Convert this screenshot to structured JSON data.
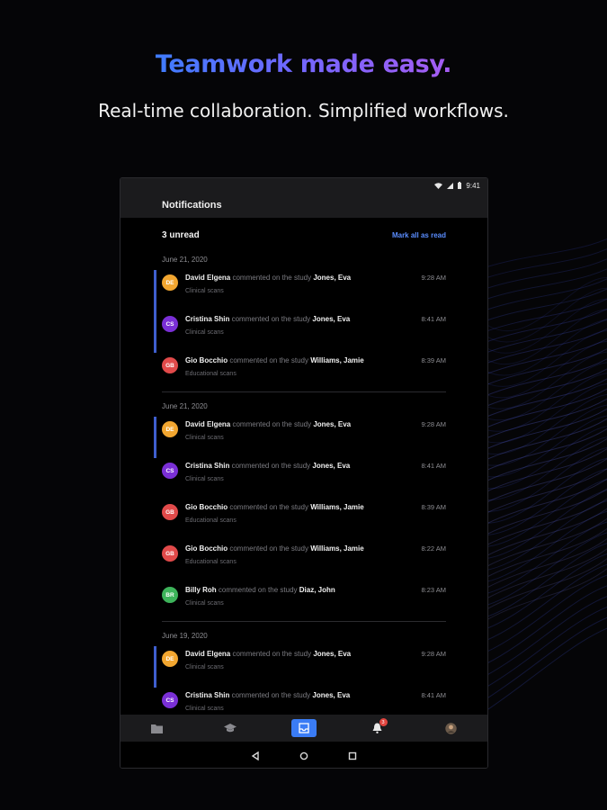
{
  "hero": {
    "title": "Teamwork made easy.",
    "subtitle": "Real-time collaboration. Simplified workflows."
  },
  "statusbar": {
    "time": "9:41"
  },
  "appbar": {
    "title": "Notifications"
  },
  "summary": {
    "unread": "3 unread",
    "mark_all": "Mark all as read"
  },
  "colors": {
    "accent": "#3a7cf5",
    "link": "#5a8dff",
    "unread_bar": "#3f5fcf",
    "badge": "#e0453f"
  },
  "groups": [
    {
      "date": "June 21, 2020",
      "items": [
        {
          "initials": "DE",
          "color": "#f2a630",
          "name": "David Elgena",
          "action": "commented on the study",
          "study": "Jones, Eva",
          "subtitle": "Clinical scans",
          "time": "9:28 AM",
          "unread": true
        },
        {
          "initials": "CS",
          "color": "#7a2fd6",
          "name": "Cristina Shin",
          "action": "commented on the study",
          "study": "Jones, Eva",
          "subtitle": "Clinical scans",
          "time": "8:41 AM",
          "unread": true
        },
        {
          "initials": "GB",
          "color": "#e14a4a",
          "name": "Gio Bocchio",
          "action": "commented on the study",
          "study": "Williams, Jamie",
          "subtitle": "Educational scans",
          "time": "8:39 AM",
          "unread": false
        }
      ]
    },
    {
      "date": "June 21, 2020",
      "items": [
        {
          "initials": "DE",
          "color": "#f2a630",
          "name": "David Elgena",
          "action": "commented on the study",
          "study": "Jones, Eva",
          "subtitle": "Clinical scans",
          "time": "9:28 AM",
          "unread": true
        },
        {
          "initials": "CS",
          "color": "#7a2fd6",
          "name": "Cristina Shin",
          "action": "commented on the study",
          "study": "Jones, Eva",
          "subtitle": "Clinical scans",
          "time": "8:41 AM",
          "unread": false
        },
        {
          "initials": "GB",
          "color": "#e14a4a",
          "name": "Gio Bocchio",
          "action": "commented on the study",
          "study": "Williams, Jamie",
          "subtitle": "Educational scans",
          "time": "8:39 AM",
          "unread": false
        },
        {
          "initials": "GB",
          "color": "#e14a4a",
          "name": "Gio Bocchio",
          "action": "commented on the study",
          "study": "Williams, Jamie",
          "subtitle": "Educational scans",
          "time": "8:22 AM",
          "unread": false
        },
        {
          "initials": "BR",
          "color": "#3db35a",
          "name": "Billy Roh",
          "action": "commented on the study",
          "study": "Diaz, John",
          "subtitle": "Clinical scans",
          "time": "8:23 AM",
          "unread": false
        }
      ]
    },
    {
      "date": "June 19, 2020",
      "items": [
        {
          "initials": "DE",
          "color": "#f2a630",
          "name": "David Elgena",
          "action": "commented on the study",
          "study": "Jones, Eva",
          "subtitle": "Clinical scans",
          "time": "9:28 AM",
          "unread": true
        },
        {
          "initials": "CS",
          "color": "#7a2fd6",
          "name": "Cristina Shin",
          "action": "commented on the study",
          "study": "Jones, Eva",
          "subtitle": "Clinical scans",
          "time": "8:41 AM",
          "unread": false
        }
      ]
    }
  ],
  "tabbar": {
    "tabs": [
      {
        "icon": "folder-icon",
        "active": false
      },
      {
        "icon": "graduation-cap-icon",
        "active": false
      },
      {
        "icon": "inbox-tray-icon",
        "active": true
      },
      {
        "icon": "bell-icon",
        "active": false,
        "badge": "3"
      },
      {
        "icon": "profile-avatar-icon",
        "active": false
      }
    ]
  },
  "navbar": {
    "icons": [
      "back-triangle-icon",
      "home-circle-icon",
      "recents-square-icon"
    ]
  }
}
